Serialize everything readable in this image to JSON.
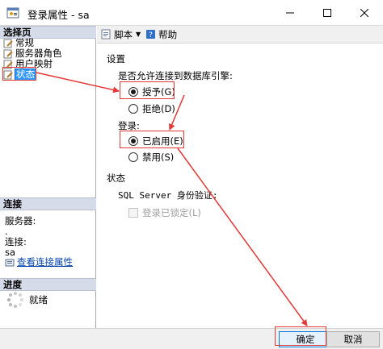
{
  "window": {
    "title": "登录属性 - sa"
  },
  "left": {
    "select_page_header": "选择页",
    "pages": [
      {
        "label": "常规"
      },
      {
        "label": "服务器角色"
      },
      {
        "label": "用户映射"
      },
      {
        "label": "状态"
      }
    ],
    "connection_header": "连接",
    "server_label": "服务器:",
    "server_value": ".",
    "connection_label": "连接:",
    "connection_value": "sa",
    "view_connection_link": "查看连接属性",
    "progress_header": "进度",
    "progress_status": "就绪"
  },
  "toolbar": {
    "script_label": "脚本",
    "help_label": "帮助"
  },
  "settings": {
    "section_label": "设置",
    "db_engine_question": "是否允许连接到数据库引擎:",
    "grant_label": "授予(G)",
    "deny_label": "拒绝(D)",
    "grant_selected": true,
    "login_label": "登录:",
    "enabled_label": "已启用(E)",
    "disabled_label": "禁用(S)",
    "enabled_selected": true
  },
  "status": {
    "section_label": "状态",
    "auth_label": "SQL Server 身份验证:",
    "locked_label": "登录已锁定(L)",
    "locked_checked": false
  },
  "buttons": {
    "ok_label": "确定",
    "cancel_label": "取消"
  },
  "colors": {
    "highlight": "#e23838",
    "selection": "#3399ff",
    "link": "#0645ad"
  }
}
